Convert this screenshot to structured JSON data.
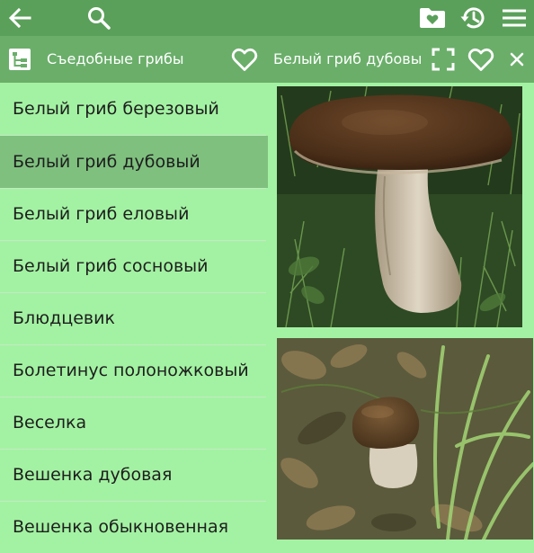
{
  "header": {
    "icons": {
      "back": "back-arrow-icon",
      "search": "search-icon",
      "folder": "folder-heart-icon",
      "history": "history-icon",
      "menu": "menu-icon"
    }
  },
  "subheader": {
    "category_label": "Съедобные грибы",
    "item_label": "Белый гриб дубовы",
    "icons": {
      "tree": "tree-structure-icon",
      "favorite_category": "heart-outline-icon",
      "fullscreen": "fullscreen-icon",
      "favorite_item": "heart-outline-icon",
      "close": "close-icon"
    }
  },
  "list": {
    "items": [
      {
        "label": "Белый гриб березовый",
        "selected": false
      },
      {
        "label": "Белый гриб дубовый",
        "selected": true
      },
      {
        "label": "Белый гриб еловый",
        "selected": false
      },
      {
        "label": "Белый гриб сосновый",
        "selected": false
      },
      {
        "label": "Блюдцевик",
        "selected": false
      },
      {
        "label": "Болетинус полоножковый",
        "selected": false
      },
      {
        "label": "Веселка",
        "selected": false
      },
      {
        "label": "Вешенка дубовая",
        "selected": false
      },
      {
        "label": "Вешенка обыкновенная",
        "selected": false
      }
    ]
  },
  "colors": {
    "topbar": "#5aa05a",
    "subbar": "#6aae6a",
    "list_bg": "#a3f2a3",
    "selected_bg": "#7fc07f"
  }
}
